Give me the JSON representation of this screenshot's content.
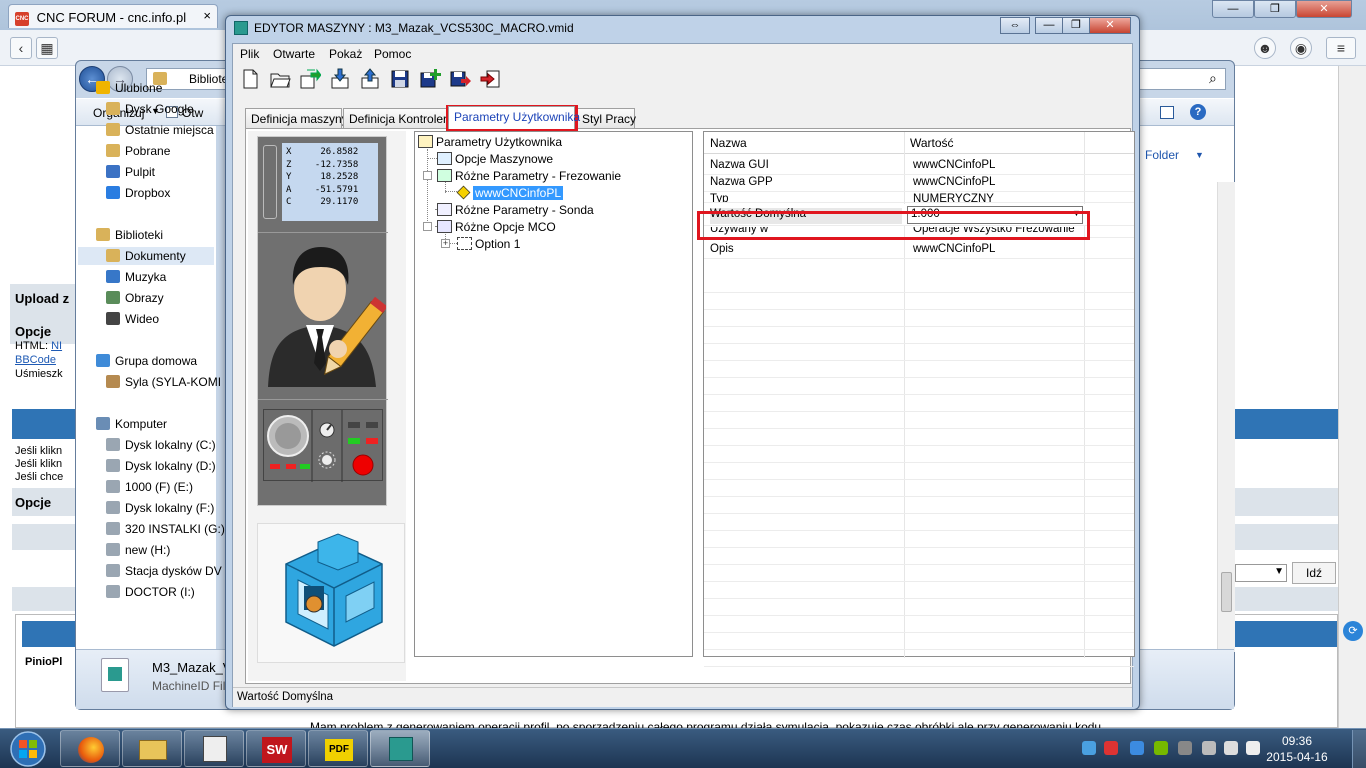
{
  "browser": {
    "tab_title": "CNC FORUM - cnc.info.pl",
    "tab_logo": "CNC",
    "close_glyph": "×",
    "window_controls": [
      "—",
      "❐",
      "✕"
    ],
    "forum_texts": {
      "upload": "Upload z",
      "options1": "Opcje",
      "html": "HTML:",
      "html_link": "NI",
      "bbcode": "BBCode",
      "smileys": "Uśmieszk",
      "jesli1": "Jeśli klikn",
      "jesli2": "Jeśli klikn",
      "jesli3": "Jeśli chce",
      "options2": "Opcje",
      "user": "PinioPl",
      "idz": "Idź",
      "post": "Mam problem z generowaniem operacji profil, po sporządzeniu całego programu działa symulacja, pokazuje czas obróbki ale przy generowaniu kodu"
    }
  },
  "explorer": {
    "address_crumb": "Bibliote",
    "organize": "Organizuj",
    "open": "Otw",
    "new_folder": "Folder",
    "nav_items": [
      {
        "label": "Ulubione",
        "color": "#f0b400"
      },
      {
        "label": "Dysk Google",
        "color": "#d9b25a"
      },
      {
        "label": "Ostatnie miejsca",
        "color": "#d9b25a"
      },
      {
        "label": "Pobrane",
        "color": "#d9b25a"
      },
      {
        "label": "Pulpit",
        "color": "#3b72c4"
      },
      {
        "label": "Dropbox",
        "color": "#2a7de1"
      },
      {
        "label": "Biblioteki",
        "color": "#d9b25a"
      },
      {
        "label": "Dokumenty",
        "color": "#d9b25a"
      },
      {
        "label": "Muzyka",
        "color": "#3777c8"
      },
      {
        "label": "Obrazy",
        "color": "#5a8c5a"
      },
      {
        "label": "Wideo",
        "color": "#444444"
      },
      {
        "label": "Grupa domowa",
        "color": "#3f8bd8"
      },
      {
        "label": "Syla (SYLA-KOMI",
        "color": "#b58a50"
      },
      {
        "label": "Komputer",
        "color": "#6a8db5"
      },
      {
        "label": "Dysk lokalny (C:)",
        "color": "#9aa6b2"
      },
      {
        "label": "Dysk lokalny (D:)",
        "color": "#9aa6b2"
      },
      {
        "label": "1000 (F) (E:)",
        "color": "#9aa6b2"
      },
      {
        "label": "Dysk lokalny (F:)",
        "color": "#9aa6b2"
      },
      {
        "label": "320 INSTALKI (G:)",
        "color": "#9aa6b2"
      },
      {
        "label": "new (H:)",
        "color": "#9aa6b2"
      },
      {
        "label": "Stacja dysków DV",
        "color": "#9aa6b2"
      },
      {
        "label": "DOCTOR (I:)",
        "color": "#9aa6b2"
      }
    ],
    "details": {
      "filename": "M3_Mazak_V",
      "filetype": "MachineID Fil"
    }
  },
  "editor": {
    "title": "EDYTOR MASZYNY : M3_Mazak_VCS530C_MACRO.vmid",
    "title_buttons": [
      "⇔",
      "—",
      "❐",
      "✕"
    ],
    "menu": [
      "Plik",
      "Otwarte",
      "Pokaż",
      "Pomoc"
    ],
    "toolbar": [
      "new-file",
      "open-folder",
      "export-green",
      "import-blue",
      "export-blue",
      "save",
      "add-green",
      "save-as",
      "exit-red"
    ],
    "tabs": [
      "Definicja maszyny",
      "Definicja Kontrolera",
      "Parametry Użytkownika",
      "Styl Pracy"
    ],
    "active_tab": "Parametry Użytkownika",
    "cnc_screen": [
      {
        "axis": "X",
        "value": "26.8582"
      },
      {
        "axis": "Z",
        "value": "-12.7358"
      },
      {
        "axis": "Y",
        "value": "18.2528"
      },
      {
        "axis": "A",
        "value": "-51.5791"
      },
      {
        "axis": "C",
        "value": "29.1170"
      }
    ],
    "tree": {
      "root": "Parametry Użytkownika",
      "opcje": "Opcje Maszynowe",
      "frez": "Różne Parametry - Frezowanie",
      "selected": "wwwCNCinfoPL",
      "sonda": "Różne Parametry - Sonda",
      "mco": "Różne Opcje MCO",
      "option1": "Option 1",
      "plus": "+"
    },
    "grid": {
      "col_name": "Nazwa",
      "col_value": "Wartość",
      "rows": [
        {
          "name": "Nazwa GUI",
          "value": "wwwCNCinfoPL"
        },
        {
          "name": "Nazwa GPP",
          "value": "wwwCNCinfoPL"
        },
        {
          "name": "Typ",
          "value": "NUMERYCZNY"
        },
        {
          "name": "Wartość Domyślna",
          "value": "1.000"
        },
        {
          "name": "Używany w",
          "value": "Operacje Wszystko Frezowanie"
        },
        {
          "name": "Opis",
          "value": "wwwCNCinfoPL"
        }
      ],
      "dropdown_arrow": "▼"
    },
    "status": "Wartość Domyślna",
    "highlight_color": "#e0161f"
  },
  "taskbar": {
    "time": "09:36",
    "date": "2015-04-16",
    "app_labels": [
      "SW",
      "PDF"
    ]
  }
}
